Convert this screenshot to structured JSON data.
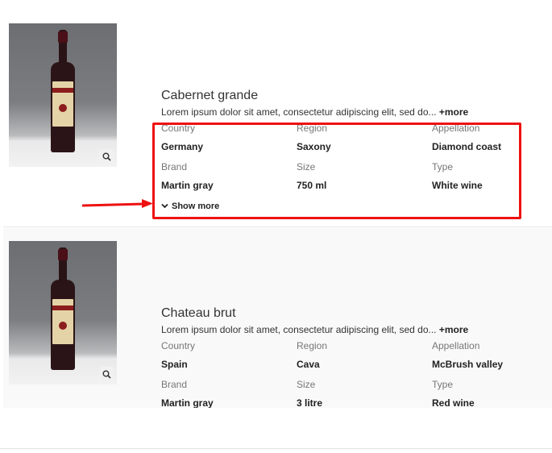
{
  "products": [
    {
      "title": "Cabernet grande",
      "description": "Lorem ipsum dolor sit amet, consectetur adipiscing elit, sed do...",
      "more_label": "+more",
      "attributes": [
        {
          "key": "Country",
          "value": "Germany"
        },
        {
          "key": "Region",
          "value": "Saxony"
        },
        {
          "key": "Appellation",
          "value": "Diamond coast"
        },
        {
          "key": "Brand",
          "value": "Martin gray"
        },
        {
          "key": "Size",
          "value": "750 ml"
        },
        {
          "key": "Type",
          "value": "White wine"
        }
      ],
      "show_more_label": "Show more",
      "image_icon": "wine-bottle-photo",
      "zoom_icon": "magnifier-icon"
    },
    {
      "title": "Chateau brut",
      "description": "Lorem ipsum dolor sit amet, consectetur adipiscing elit, sed do...",
      "more_label": "+more",
      "attributes": [
        {
          "key": "Country",
          "value": "Spain"
        },
        {
          "key": "Region",
          "value": "Cava"
        },
        {
          "key": "Appellation",
          "value": "McBrush valley"
        },
        {
          "key": "Brand",
          "value": "Martin gray"
        },
        {
          "key": "Size",
          "value": "3 litre"
        },
        {
          "key": "Type",
          "value": "Red wine"
        }
      ],
      "image_icon": "wine-bottle-photo",
      "zoom_icon": "magnifier-icon"
    }
  ],
  "annotation": {
    "highlight_color": "#ee1111",
    "arrow_color": "#ee1111"
  }
}
